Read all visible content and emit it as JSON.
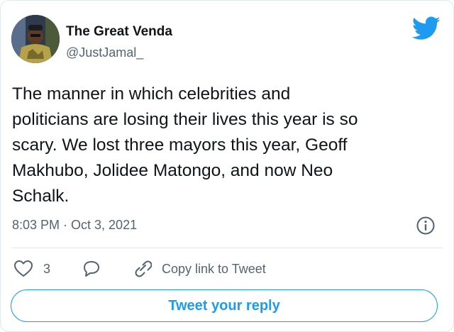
{
  "author": {
    "display_name": "The Great Venda",
    "handle": "@JustJamal_"
  },
  "tweet": {
    "text": "The manner in which celebrities and\npoliticians are losing their lives this year is so\nscary. We lost three mayors this year, Geoff\nMakhubo, Jolidee Matongo, and now Neo\nSchalk.",
    "timestamp": "8:03 PM · Oct 3, 2021"
  },
  "actions": {
    "like_count": "3",
    "copy_link_label": "Copy link to Tweet",
    "reply_button_label": "Tweet your reply"
  },
  "icons": {
    "brand": "twitter-bird-icon",
    "info": "info-icon",
    "like": "heart-icon",
    "reply": "speech-bubble-icon",
    "copy_link": "link-icon"
  },
  "colors": {
    "accent": "#1d9bf0",
    "text_primary": "#0f1419",
    "text_secondary": "#536471",
    "border": "#e1e8ed"
  }
}
